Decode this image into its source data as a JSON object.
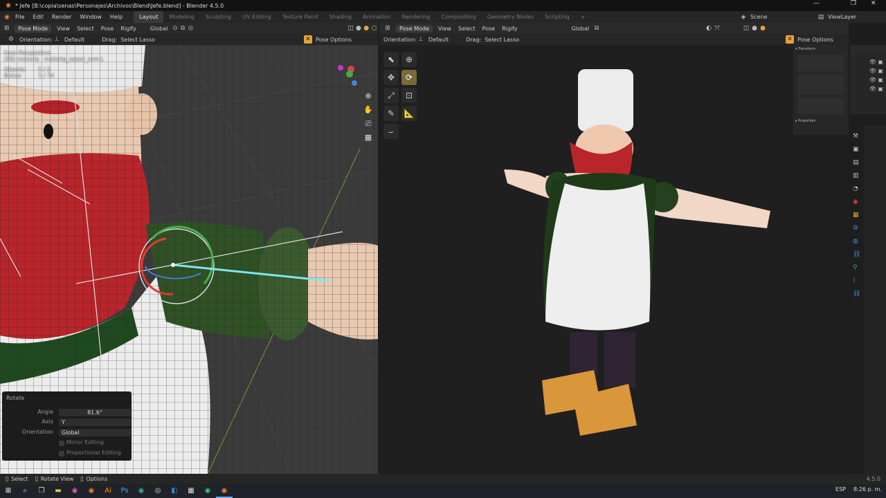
{
  "window": {
    "title": "* Jefe [B:\\copia\\senas\\Personajes\\Archivos\\Blend\\Jefe.blend] - Blender 4.5.0"
  },
  "menus": [
    "File",
    "Edit",
    "Render",
    "Window",
    "Help"
  ],
  "workspaces": [
    "Layout",
    "Modeling",
    "Sculpting",
    "UV Editing",
    "Texture Paint",
    "Shading",
    "Animation",
    "Rendering",
    "Compositing",
    "Geometry Nodes",
    "Scripting"
  ],
  "scene": {
    "name": "Scene",
    "view_layer": "ViewLayer"
  },
  "left_header": {
    "mode": "Pose Mode",
    "items": [
      "View",
      "Select",
      "Pose",
      "Rigify"
    ],
    "transform": "Global"
  },
  "left_subheader": {
    "orientation_label": "Orientation:",
    "orientation": "Default",
    "drag_label": "Drag:",
    "drag": "Select Lasso",
    "options": "Pose Options"
  },
  "right_header": {
    "mode": "Pose Mode",
    "items": [
      "View",
      "Select",
      "Pose",
      "Rigify"
    ],
    "transform": "Global"
  },
  "right_subheader": {
    "orientation_label": "Orientation:",
    "orientation": "Default",
    "drag_label": "Drag:",
    "drag": "Select Lasso",
    "options": "Pose Options"
  },
  "viewport_info": {
    "line1": "User Perspective",
    "line2": "(86) metarig : metarig_upper_arm.L",
    "objects": "Objects",
    "objects_val": "1 / 2",
    "bones": "Bones",
    "bones_val": "1 / 74"
  },
  "operator_panel": {
    "title": "Rotate",
    "angle_label": "Angle",
    "angle": "81.6°",
    "axis_label": "Axis",
    "axis": "Y",
    "orientation_label": "Orientation",
    "orientation": "Global",
    "mirror": "Mirror Editing",
    "proportional": "Proportional Editing"
  },
  "status_bar": {
    "select": "Select",
    "rotate": "Rotate View",
    "options": "Options",
    "version": "4.5.0"
  },
  "taskbar": {
    "lang": "ESP",
    "time": "8:26 p. m."
  },
  "colors": {
    "accent": "#e8a33a",
    "active_tool": "#7a6a3a",
    "bg": "#1d1d1d"
  }
}
